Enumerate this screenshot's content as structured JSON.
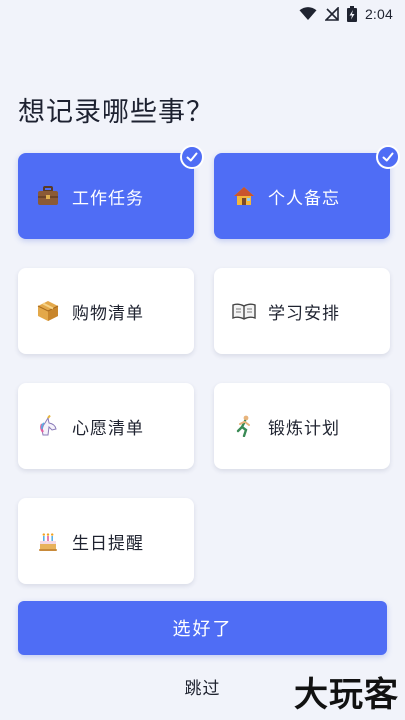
{
  "status_bar": {
    "time": "2:04",
    "icons": [
      "wifi-icon",
      "signal-off-icon",
      "battery-charging-icon"
    ]
  },
  "page": {
    "title": "想记录哪些事？"
  },
  "categories": [
    {
      "label": "工作任务",
      "icon": "briefcase-icon",
      "selected": true
    },
    {
      "label": "个人备忘",
      "icon": "house-icon",
      "selected": true
    },
    {
      "label": "购物清单",
      "icon": "package-icon",
      "selected": false
    },
    {
      "label": "学习安排",
      "icon": "open-book-icon",
      "selected": false
    },
    {
      "label": "心愿清单",
      "icon": "unicorn-icon",
      "selected": false
    },
    {
      "label": "锻炼计划",
      "icon": "runner-icon",
      "selected": false
    },
    {
      "label": "生日提醒",
      "icon": "birthday-cake-icon",
      "selected": false
    }
  ],
  "actions": {
    "confirm_label": "选好了",
    "skip_label": "跳过"
  },
  "watermark": "大玩客",
  "colors": {
    "accent": "#4f6df5",
    "background": "#f1f3fa",
    "card": "#ffffff"
  }
}
